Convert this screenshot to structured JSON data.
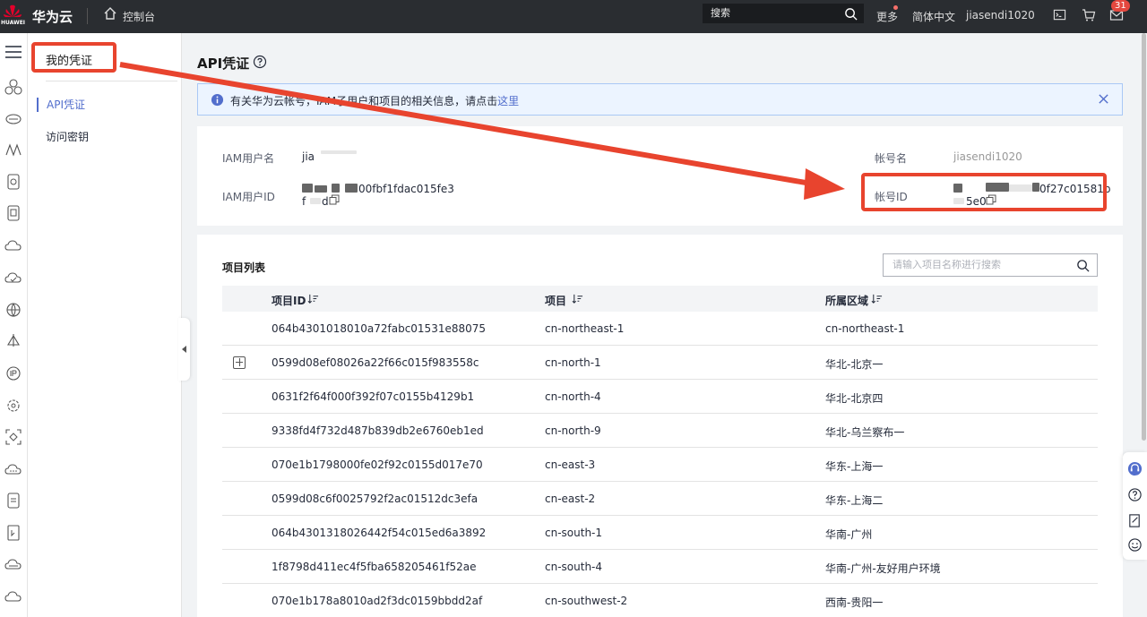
{
  "topbar": {
    "brand": "华为云",
    "logo_text": "HUAWEI",
    "console": "控制台",
    "search_placeholder": "搜索",
    "more": "更多",
    "language": "简体中文",
    "username": "jiasendi1020",
    "mail_count": "31",
    "icons": [
      "home-icon",
      "search-icon",
      "terminal-icon",
      "cart-icon",
      "mail-icon"
    ]
  },
  "submenu": {
    "title": "我的凭证",
    "items": [
      {
        "label": "API凭证",
        "active": true
      },
      {
        "label": "访问密钥",
        "active": false
      }
    ]
  },
  "page": {
    "title": "API凭证",
    "notice_text": "有关华为云帐号，IAM子用户和项目的相关信息，请点击",
    "notice_link": "这里"
  },
  "credentials": {
    "iam_user_label": "IAM用户名",
    "iam_user_value": "jia",
    "iam_id_label": "IAM用户ID",
    "iam_id_value_line1": "00fbf1fdac015fe3",
    "iam_id_value_line2": "f",
    "iam_id_value_line2b": "d",
    "account_name_label": "帐号名",
    "account_name_value": "jiasendi1020",
    "account_id_label": "帐号ID",
    "account_id_value_line1": "0f27c01581b",
    "account_id_value_line2": "5e0"
  },
  "projects": {
    "title": "项目列表",
    "search_placeholder": "请输入项目名称进行搜索",
    "columns": [
      "项目ID",
      "项目",
      "所属区域"
    ],
    "rows": [
      {
        "id": "064b4301018010a72fabc01531e88075",
        "project": "cn-northeast-1",
        "region": "cn-northeast-1"
      },
      {
        "id": "0599d08ef08026a22f66c015f983558c",
        "project": "cn-north-1",
        "region": "华北-北京一"
      },
      {
        "id": "0631f2f64f000f392f07c0155b4129b1",
        "project": "cn-north-4",
        "region": "华北-北京四"
      },
      {
        "id": "9338fd4f732d487b839db2e6760eb1ed",
        "project": "cn-north-9",
        "region": "华北-乌兰察布一"
      },
      {
        "id": "070e1b1798000fe02f92c0155d017e70",
        "project": "cn-east-3",
        "region": "华东-上海一"
      },
      {
        "id": "0599d08c6f0025792f2ac01512dc3efa",
        "project": "cn-east-2",
        "region": "华东-上海二"
      },
      {
        "id": "064b4301318026442f54c015ed6a3892",
        "project": "cn-south-1",
        "region": "华南-广州"
      },
      {
        "id": "1f8798d411ec4f5fba658205461f52ae",
        "project": "cn-south-4",
        "region": "华南-广州-友好用户环境"
      },
      {
        "id": "070e1b178a8010ad2f3dc0159bbdd2af",
        "project": "cn-southwest-2",
        "region": "西南-贵阳一"
      }
    ]
  },
  "colors": {
    "accent": "#526ecc",
    "annotation": "#e8442e",
    "topbar_bg": "#2a2d31"
  }
}
